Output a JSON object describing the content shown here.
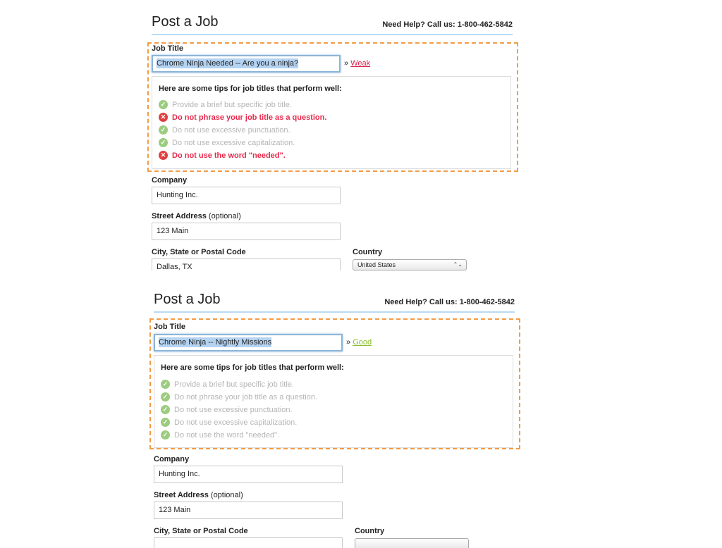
{
  "colors": {
    "accent_border": "#f29c46",
    "header_rule": "#b9daf1",
    "error_text": "#e8284a",
    "pass_text": "#b5b5b5",
    "weak": "#d9244e",
    "good": "#8bbf2e"
  },
  "panels": [
    {
      "title": "Post a Job",
      "help": "Need Help? Call us: 1-800-462-5842",
      "job_title_label": "Job Title",
      "job_title_value": "Chrome Ninja Needed -- Are you a ninja?",
      "strength_prefix": "»",
      "strength": "Weak",
      "strength_color": "#d9244e",
      "tips_heading": "Here are some tips for job titles that perform well:",
      "tips": [
        {
          "text": "Provide a brief but specific job title.",
          "status": "pass",
          "icon": "check-circle-icon",
          "glyph": "✓"
        },
        {
          "text": "Do not phrase your job title as a question.",
          "status": "fail",
          "icon": "x-circle-icon",
          "glyph": "✕"
        },
        {
          "text": "Do not use excessive punctuation.",
          "status": "pass",
          "icon": "check-circle-icon",
          "glyph": "✓"
        },
        {
          "text": "Do not use excessive capitalization.",
          "status": "pass",
          "icon": "check-circle-icon",
          "glyph": "✓"
        },
        {
          "text": "Do not use the word \"needed\".",
          "status": "fail",
          "icon": "x-circle-icon",
          "glyph": "✕"
        }
      ],
      "company_label": "Company",
      "company_value": "Hunting Inc.",
      "street_label": "Street Address",
      "street_optional": "(optional)",
      "street_value": "123 Main",
      "city_label": "City, State or Postal Code",
      "city_value": "Dallas, TX",
      "country_label": "Country",
      "country_value": "United States",
      "select_arrows": "⌃⌄"
    },
    {
      "title": "Post a Job",
      "help": "Need Help? Call us: 1-800-462-5842",
      "job_title_label": "Job Title",
      "job_title_value": "Chrome Ninja -- Nightly Missions",
      "strength_prefix": "»",
      "strength": "Good",
      "strength_color": "#8bbf2e",
      "tips_heading": "Here are some tips for job titles that perform well:",
      "tips": [
        {
          "text": "Provide a brief but specific job title.",
          "status": "pass",
          "icon": "check-circle-icon",
          "glyph": "✓"
        },
        {
          "text": "Do not phrase your job title as a question.",
          "status": "pass",
          "icon": "check-circle-icon",
          "glyph": "✓"
        },
        {
          "text": "Do not use excessive punctuation.",
          "status": "pass",
          "icon": "check-circle-icon",
          "glyph": "✓"
        },
        {
          "text": "Do not use excessive capitalization.",
          "status": "pass",
          "icon": "check-circle-icon",
          "glyph": "✓"
        },
        {
          "text": "Do not use the word \"needed\".",
          "status": "pass",
          "icon": "check-circle-icon",
          "glyph": "✓"
        }
      ],
      "company_label": "Company",
      "company_value": "Hunting Inc.",
      "street_label": "Street Address",
      "street_optional": "(optional)",
      "street_value": "123 Main",
      "city_label": "City, State or Postal Code",
      "city_value": "",
      "country_label": "Country",
      "country_value": "",
      "select_arrows": ""
    }
  ]
}
